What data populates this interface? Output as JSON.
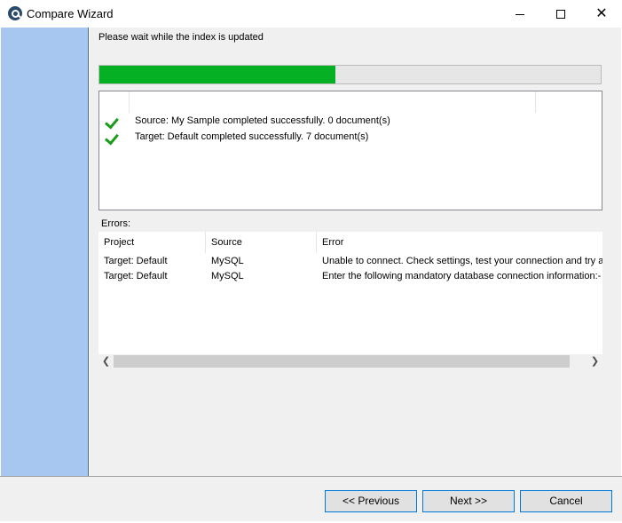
{
  "window": {
    "title": "Compare Wizard",
    "icons": {
      "app": "search-logo-icon",
      "minimize": "minimize-icon",
      "maximize": "maximize-icon",
      "close": "close-icon"
    }
  },
  "main": {
    "heading": "Please wait while the index is updated",
    "progress": {
      "fraction": 0.47,
      "color": "#06b025"
    },
    "status": [
      {
        "icon": "check-icon",
        "text": "Source: My Sample completed successfully. 0 document(s)"
      },
      {
        "icon": "check-icon",
        "text": "Target: Default completed successfully. 7 document(s)"
      }
    ],
    "errors_label": "Errors:",
    "errors": {
      "columns": [
        "Project",
        "Source",
        "Error"
      ],
      "rows": [
        [
          "Target: Default",
          "MySQL",
          "Unable to connect.  Check settings, test your connection and try ag"
        ],
        [
          "Target: Default",
          "MySQL",
          "Enter the following mandatory database connection information:- Ho"
        ]
      ]
    }
  },
  "footer": {
    "previous": "<< Previous",
    "next": "Next >>",
    "cancel": "Cancel"
  },
  "colors": {
    "sidebar": "#a8c7f0",
    "accent": "#0078d7",
    "check": "#1a9b1a"
  }
}
